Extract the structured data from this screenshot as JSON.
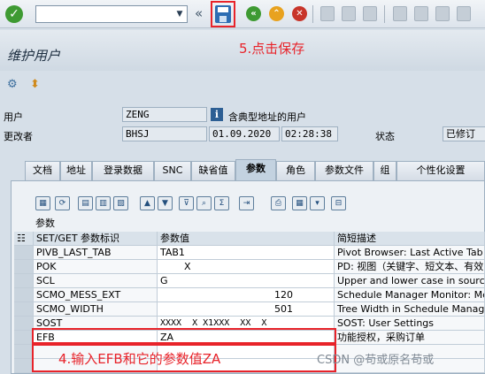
{
  "toolbar": {
    "ok_icon": "check-icon",
    "command_field_value": "",
    "back_symbol": "«",
    "save_icon": "save-icon",
    "colors": {
      "save_highlight": "#e8232a",
      "ok": "#3e9a32",
      "back": "#3e9a32",
      "exit": "#e8a21f",
      "cancel": "#c8352a"
    }
  },
  "annotations": {
    "step5": "5.点击保存",
    "step4": "4.输入EFB和它的参数值ZA",
    "watermark": "CSDN @苟或原名苟或"
  },
  "page": {
    "title": "维护用户"
  },
  "header": {
    "user_label": "用户",
    "user_value": "ZENG",
    "user_type_text": "含典型地址的用户",
    "changed_by_label": "更改者",
    "changed_by_value": "BHSJ",
    "date_value": "01.09.2020",
    "time_value": "02:28:38",
    "status_label": "状态",
    "status_value": "已修订"
  },
  "tabs": [
    {
      "label": "文档"
    },
    {
      "label": "地址"
    },
    {
      "label": "登录数据"
    },
    {
      "label": "SNC"
    },
    {
      "label": "缺省值"
    },
    {
      "label": "参数"
    },
    {
      "label": "角色"
    },
    {
      "label": "参数文件"
    },
    {
      "label": "组"
    },
    {
      "label": "个性化设置"
    }
  ],
  "active_tab": "参数",
  "grid": {
    "title": "参数",
    "columns": [
      "SET/GET 参数标识",
      "参数值",
      "简短描述"
    ],
    "rows": [
      {
        "id": "PIVB_LAST_TAB",
        "value": "TAB1",
        "desc": "Pivot Browser: Last Active Tab"
      },
      {
        "id": "POK",
        "value": "X",
        "desc": "PD: 视图（关键字、短文本、有效"
      },
      {
        "id": "SCL",
        "value": "G",
        "desc": "Upper and lower case in source co"
      },
      {
        "id": "SCMO_MESS_EXT",
        "value": "120",
        "desc": "Schedule Manager Monitor: Messa"
      },
      {
        "id": "SCMO_WIDTH",
        "value": "501",
        "desc": "Tree Width in Schedule Manager M"
      },
      {
        "id": "SOST",
        "value": "XXXX  X X1XXX  XX  X",
        "desc": "SOST: User Settings"
      },
      {
        "id": "EFB",
        "value": "ZA",
        "desc": "功能授权，采购订单"
      }
    ]
  }
}
